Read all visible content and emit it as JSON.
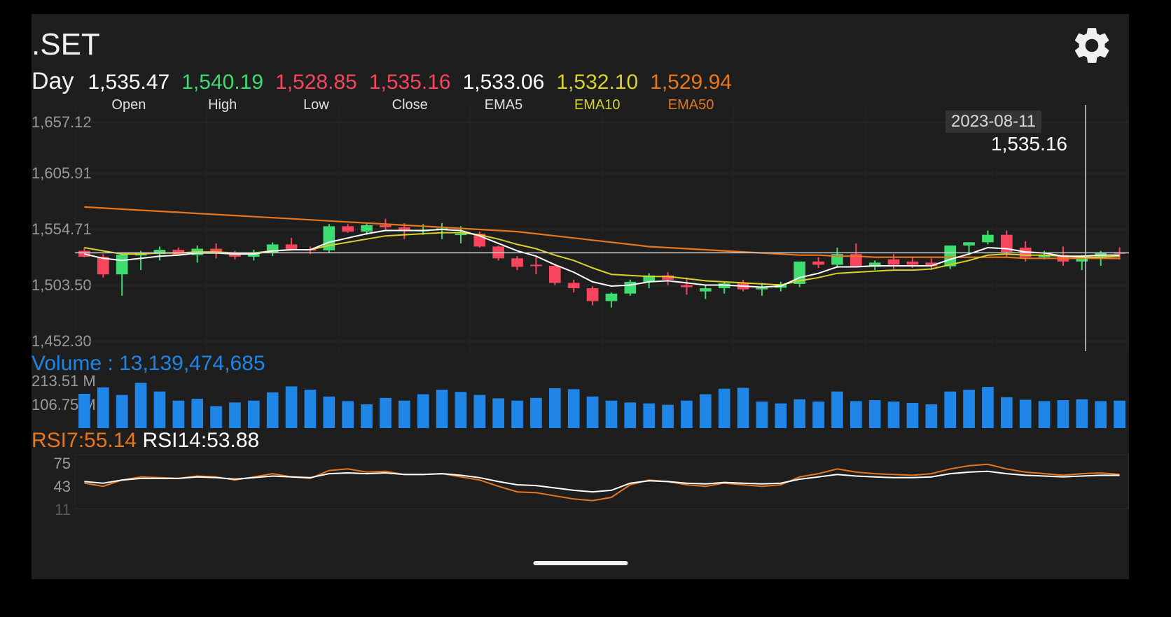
{
  "header": {
    "symbol": ".SET",
    "timeframe": "Day",
    "ohlc": [
      {
        "label": "Open",
        "value": "1,535.47",
        "color": "#ffffff"
      },
      {
        "label": "High",
        "value": "1,540.19",
        "color": "#3ddc6f"
      },
      {
        "label": "Low",
        "value": "1,528.85",
        "color": "#f7455d"
      },
      {
        "label": "Close",
        "value": "1,535.16",
        "color": "#f7455d"
      },
      {
        "label": "EMA5",
        "value": "1,533.06",
        "color": "#ffffff"
      },
      {
        "label": "EMA10",
        "value": "1,532.10",
        "color": "#d8d32a"
      },
      {
        "label": "EMA50",
        "value": "1,529.94",
        "color": "#e8761c"
      }
    ]
  },
  "crosshair": {
    "date": "2023-08-11",
    "price": "1,535.16"
  },
  "price_chart": {
    "y_ticks": [
      "1,657.12",
      "1,605.91",
      "1,554.71",
      "1,503.50",
      "1,452.30"
    ]
  },
  "volume": {
    "label": "Volume : ",
    "value": "13,139,474,685",
    "y_ticks": [
      "213.51 M",
      "106.75 M"
    ]
  },
  "rsi": {
    "rsi7_readout": "RSI7:55.14",
    "rsi14_readout": "RSI14:53.88",
    "y_ticks": [
      "75",
      "43",
      "11"
    ]
  },
  "colors": {
    "background": "#1e1e1e",
    "up": "#3ddc6f",
    "down": "#f7455d",
    "ema5": "#ffffff",
    "ema10": "#d8d32a",
    "ema50": "#e8761c",
    "volume_bar": "#1f86e8",
    "rsi7": "#e8761c",
    "rsi14": "#ffffff",
    "grid": "#2a2a2a",
    "axis_text": "#9a9a9a"
  },
  "chart_data": {
    "type": "candlestick",
    "title": ".SET",
    "subtitle": "Day",
    "ylim": [
      1452.3,
      1657.12
    ],
    "y_ticks": [
      1657.12,
      1605.91,
      1554.71,
      1503.5,
      1452.3
    ],
    "grid": true,
    "legend": [
      "EMA5",
      "EMA10",
      "EMA50"
    ],
    "crosshair_date": "2023-08-11",
    "crosshair_price": 1535.16,
    "candles": [
      {
        "o": 1537.0,
        "h": 1540.0,
        "l": 1531.0,
        "c": 1531.5
      },
      {
        "o": 1531.5,
        "h": 1534.0,
        "l": 1512.0,
        "c": 1515.0
      },
      {
        "o": 1515.0,
        "h": 1534.0,
        "l": 1495.0,
        "c": 1533.5
      },
      {
        "o": 1533.5,
        "h": 1537.0,
        "l": 1519.0,
        "c": 1534.0
      },
      {
        "o": 1534.0,
        "h": 1541.0,
        "l": 1528.0,
        "c": 1538.0
      },
      {
        "o": 1538.0,
        "h": 1540.0,
        "l": 1534.0,
        "c": 1533.0
      },
      {
        "o": 1533.0,
        "h": 1542.0,
        "l": 1526.0,
        "c": 1539.0
      },
      {
        "o": 1539.0,
        "h": 1544.0,
        "l": 1530.0,
        "c": 1534.5
      },
      {
        "o": 1534.5,
        "h": 1537.0,
        "l": 1529.0,
        "c": 1531.5
      },
      {
        "o": 1531.5,
        "h": 1538.0,
        "l": 1528.0,
        "c": 1535.5
      },
      {
        "o": 1535.5,
        "h": 1545.0,
        "l": 1532.0,
        "c": 1543.0
      },
      {
        "o": 1543.0,
        "h": 1549.0,
        "l": 1537.0,
        "c": 1538.5
      },
      {
        "o": 1538.5,
        "h": 1541.0,
        "l": 1534.0,
        "c": 1537.5
      },
      {
        "o": 1537.5,
        "h": 1562.0,
        "l": 1535.0,
        "c": 1560.0
      },
      {
        "o": 1560.0,
        "h": 1562.0,
        "l": 1554.0,
        "c": 1555.0
      },
      {
        "o": 1555.0,
        "h": 1563.0,
        "l": 1552.0,
        "c": 1561.0
      },
      {
        "o": 1561.0,
        "h": 1567.0,
        "l": 1556.0,
        "c": 1559.0
      },
      {
        "o": 1559.0,
        "h": 1563.0,
        "l": 1548.0,
        "c": 1556.0
      },
      {
        "o": 1556.0,
        "h": 1562.0,
        "l": 1552.0,
        "c": 1556.5
      },
      {
        "o": 1556.5,
        "h": 1563.0,
        "l": 1548.0,
        "c": 1558.0
      },
      {
        "o": 1552.0,
        "h": 1560.0,
        "l": 1544.0,
        "c": 1553.0
      },
      {
        "o": 1553.0,
        "h": 1555.0,
        "l": 1540.0,
        "c": 1541.0
      },
      {
        "o": 1541.0,
        "h": 1542.0,
        "l": 1528.0,
        "c": 1530.0
      },
      {
        "o": 1530.0,
        "h": 1532.0,
        "l": 1519.0,
        "c": 1522.0
      },
      {
        "o": 1524.0,
        "h": 1531.0,
        "l": 1515.0,
        "c": 1523.0
      },
      {
        "o": 1523.0,
        "h": 1525.0,
        "l": 1505.0,
        "c": 1507.0
      },
      {
        "o": 1507.0,
        "h": 1510.0,
        "l": 1498.0,
        "c": 1502.0
      },
      {
        "o": 1502.0,
        "h": 1504.0,
        "l": 1486.0,
        "c": 1490.0
      },
      {
        "o": 1490.0,
        "h": 1498.0,
        "l": 1484.0,
        "c": 1497.0
      },
      {
        "o": 1497.0,
        "h": 1510.0,
        "l": 1495.0,
        "c": 1508.0
      },
      {
        "o": 1508.0,
        "h": 1516.0,
        "l": 1502.0,
        "c": 1514.0
      },
      {
        "o": 1514.0,
        "h": 1517.0,
        "l": 1505.0,
        "c": 1510.0
      },
      {
        "o": 1505.0,
        "h": 1512.0,
        "l": 1496.0,
        "c": 1503.0
      },
      {
        "o": 1499.0,
        "h": 1505.0,
        "l": 1492.0,
        "c": 1502.0
      },
      {
        "o": 1502.0,
        "h": 1508.0,
        "l": 1497.0,
        "c": 1506.5
      },
      {
        "o": 1506.5,
        "h": 1510.0,
        "l": 1499.0,
        "c": 1501.0
      },
      {
        "o": 1501.0,
        "h": 1507.0,
        "l": 1495.0,
        "c": 1502.5
      },
      {
        "o": 1502.5,
        "h": 1508.0,
        "l": 1499.0,
        "c": 1506.0
      },
      {
        "o": 1506.0,
        "h": 1512.0,
        "l": 1503.0,
        "c": 1527.0
      },
      {
        "o": 1527.0,
        "h": 1531.0,
        "l": 1521.0,
        "c": 1524.0
      },
      {
        "o": 1524.0,
        "h": 1540.0,
        "l": 1521.0,
        "c": 1534.0
      },
      {
        "o": 1534.0,
        "h": 1544.0,
        "l": 1528.0,
        "c": 1522.0
      },
      {
        "o": 1522.0,
        "h": 1528.0,
        "l": 1519.0,
        "c": 1526.0
      },
      {
        "o": 1529.0,
        "h": 1534.0,
        "l": 1520.0,
        "c": 1524.0
      },
      {
        "o": 1527.0,
        "h": 1531.0,
        "l": 1521.0,
        "c": 1524.0
      },
      {
        "o": 1526.0,
        "h": 1530.0,
        "l": 1519.0,
        "c": 1522.5
      },
      {
        "o": 1522.5,
        "h": 1533.0,
        "l": 1520.0,
        "c": 1542.0
      },
      {
        "o": 1542.0,
        "h": 1545.0,
        "l": 1533.0,
        "c": 1545.0
      },
      {
        "o": 1545.0,
        "h": 1556.0,
        "l": 1543.0,
        "c": 1552.0
      },
      {
        "o": 1552.0,
        "h": 1556.0,
        "l": 1531.0,
        "c": 1536.0
      },
      {
        "o": 1540.0,
        "h": 1546.0,
        "l": 1527.0,
        "c": 1531.0
      },
      {
        "o": 1531.0,
        "h": 1537.0,
        "l": 1529.0,
        "c": 1533.0
      },
      {
        "o": 1533.0,
        "h": 1541.0,
        "l": 1523.0,
        "c": 1527.0
      },
      {
        "o": 1527.0,
        "h": 1533.0,
        "l": 1519.0,
        "c": 1531.0
      },
      {
        "o": 1531.0,
        "h": 1537.0,
        "l": 1523.0,
        "c": 1535.0
      },
      {
        "o": 1535.47,
        "h": 1540.19,
        "l": 1528.85,
        "c": 1535.16
      }
    ],
    "ema5": [
      1534,
      1530,
      1528,
      1530,
      1532,
      1533,
      1535,
      1535,
      1534,
      1534,
      1537,
      1538,
      1538,
      1545,
      1549,
      1553,
      1556,
      1556,
      1556,
      1557,
      1556,
      1551,
      1544,
      1537,
      1532,
      1524,
      1517,
      1508,
      1504,
      1505,
      1508,
      1509,
      1507,
      1505,
      1505,
      1504,
      1503,
      1504,
      1512,
      1516,
      1522,
      1522,
      1523,
      1523,
      1523,
      1523,
      1529,
      1534,
      1540,
      1539,
      1536,
      1535,
      1532,
      1532,
      1533,
      1533.06
    ],
    "ema10": [
      1540,
      1537,
      1534,
      1534,
      1535,
      1535,
      1536,
      1536,
      1535,
      1535,
      1537,
      1538,
      1538,
      1542,
      1545,
      1548,
      1551,
      1552,
      1553,
      1554,
      1554,
      1552,
      1548,
      1543,
      1539,
      1533,
      1528,
      1521,
      1515,
      1514,
      1513,
      1513,
      1511,
      1509,
      1508,
      1507,
      1506,
      1505,
      1509,
      1512,
      1516,
      1517,
      1518,
      1519,
      1519,
      1520,
      1524,
      1528,
      1533,
      1534,
      1533,
      1533,
      1532,
      1531,
      1531,
      1532.1
    ],
    "ema50": [
      1578,
      1577,
      1576,
      1575,
      1574,
      1573,
      1572,
      1571,
      1570,
      1569,
      1568,
      1567,
      1566,
      1565,
      1564,
      1563,
      1562,
      1561,
      1560,
      1559,
      1558,
      1557,
      1556,
      1555,
      1553,
      1551,
      1549,
      1547,
      1545,
      1543,
      1541,
      1540,
      1539,
      1538,
      1537,
      1536,
      1535,
      1534,
      1533,
      1533,
      1532,
      1532,
      1531,
      1531,
      1531,
      1531,
      1531,
      1531,
      1531,
      1531,
      1530,
      1530,
      1530,
      1530,
      1530,
      1529.94
    ],
    "volume_bars": [
      150,
      178,
      145,
      198,
      160,
      120,
      128,
      96,
      112,
      120,
      156,
      182,
      168,
      138,
      118,
      104,
      132,
      120,
      148,
      168,
      158,
      145,
      130,
      120,
      132,
      174,
      170,
      138,
      120,
      112,
      108,
      102,
      120,
      148,
      172,
      176,
      116,
      108,
      126,
      116,
      160,
      118,
      122,
      116,
      110,
      104,
      160,
      168,
      180,
      135,
      124,
      118,
      122,
      126,
      118,
      120
    ],
    "volume_ymax": 213.51,
    "volume_y_ticks": [
      213.51,
      106.75
    ],
    "rsi7": [
      44,
      40,
      48,
      52,
      51,
      50,
      53,
      52,
      48,
      52,
      56,
      52,
      50,
      60,
      62,
      58,
      59,
      55,
      55,
      56,
      52,
      48,
      40,
      33,
      32,
      28,
      24,
      22,
      26,
      42,
      48,
      46,
      42,
      40,
      44,
      42,
      40,
      42,
      52,
      56,
      62,
      58,
      56,
      55,
      54,
      56,
      62,
      66,
      68,
      62,
      58,
      56,
      54,
      56,
      57,
      55.14
    ],
    "rsi14": [
      46,
      44,
      48,
      50,
      50,
      50,
      52,
      51,
      49,
      51,
      53,
      52,
      51,
      56,
      57,
      56,
      57,
      55,
      55,
      56,
      54,
      51,
      46,
      42,
      41,
      38,
      35,
      33,
      35,
      44,
      47,
      46,
      44,
      43,
      45,
      44,
      43,
      44,
      49,
      52,
      55,
      53,
      52,
      51,
      51,
      52,
      56,
      58,
      59,
      56,
      54,
      53,
      52,
      53,
      54,
      53.88
    ],
    "rsi_y_ticks": [
      75,
      43,
      11
    ],
    "rsi_ylim": [
      11,
      80
    ]
  }
}
